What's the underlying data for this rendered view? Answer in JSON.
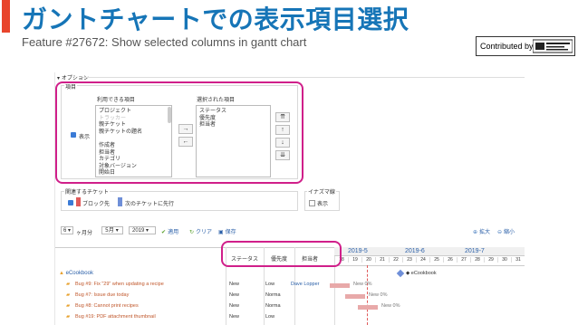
{
  "slide": {
    "title": "ガントチャートでの表示項目選択",
    "subtitle": "Feature #27672: Show selected columns in gantt chart",
    "contributed_by": "Contributed by",
    "accent_color": "#e8452c",
    "title_color": "#1675b7",
    "highlight_color": "#d01f8a"
  },
  "options": {
    "legend": "オプション",
    "columns_legend": "項目",
    "show_label": "表示",
    "available_label": "利用できる項目",
    "selected_label": "選択された項目",
    "available_items": [
      "プロジェクト",
      "トラッカー",
      "親チケット",
      "親チケットの題名",
      "",
      "作成者",
      "担当者",
      "カテゴリ",
      "対象バージョン",
      "開始日"
    ],
    "selected_items": [
      "ステータス",
      "優先度",
      "担当者"
    ],
    "move_right": "→",
    "move_left": "←",
    "move_top": "⇈",
    "move_up": "↑",
    "move_down": "↓",
    "move_bottom": "⇊"
  },
  "relations": {
    "legend": "関連するチケット",
    "blocks_label": "ブロック先",
    "blocks_color": "#e05a5a",
    "precedes_label": "次のチケットに先行",
    "precedes_color": "#6f8fd8"
  },
  "milestones": {
    "legend": "イナズマ線",
    "show_label": "表示"
  },
  "toolbar": {
    "months_value": "6",
    "months_suffix": "ヶ月分",
    "month_value": "5月",
    "year_value": "2019",
    "apply_label": "適用",
    "clear_label": "クリア",
    "save_label": "保存",
    "zoom_in_label": "拡大",
    "zoom_out_label": "縮小"
  },
  "gantt": {
    "columns": [
      "ステータス",
      "優先度",
      "担当者"
    ],
    "month_headers": [
      "2019-5",
      "2019-6",
      "2019-7"
    ],
    "weeks": [
      "18",
      "19",
      "20",
      "21",
      "22",
      "23",
      "24",
      "25",
      "26",
      "27",
      "28",
      "29",
      "30",
      "31"
    ],
    "project": "eCookbook",
    "issues": [
      {
        "subject": "Bug #9: Fix \"29\" when updating a recipe",
        "status": "New",
        "priority": "Low",
        "assignee": "Dave Lopper",
        "progress": "New 0%"
      },
      {
        "subject": "Bug #7: Issue due today",
        "status": "New",
        "priority": "Norma",
        "assignee": "",
        "progress": "New 0%"
      },
      {
        "subject": "Bug #8: Cannot print recipes",
        "status": "New",
        "priority": "Norma",
        "assignee": "",
        "progress": "New 0%"
      },
      {
        "subject": "Bug #19: PDF attachment thumbnail",
        "status": "New",
        "priority": "Low",
        "assignee": "",
        "progress": ""
      }
    ]
  }
}
